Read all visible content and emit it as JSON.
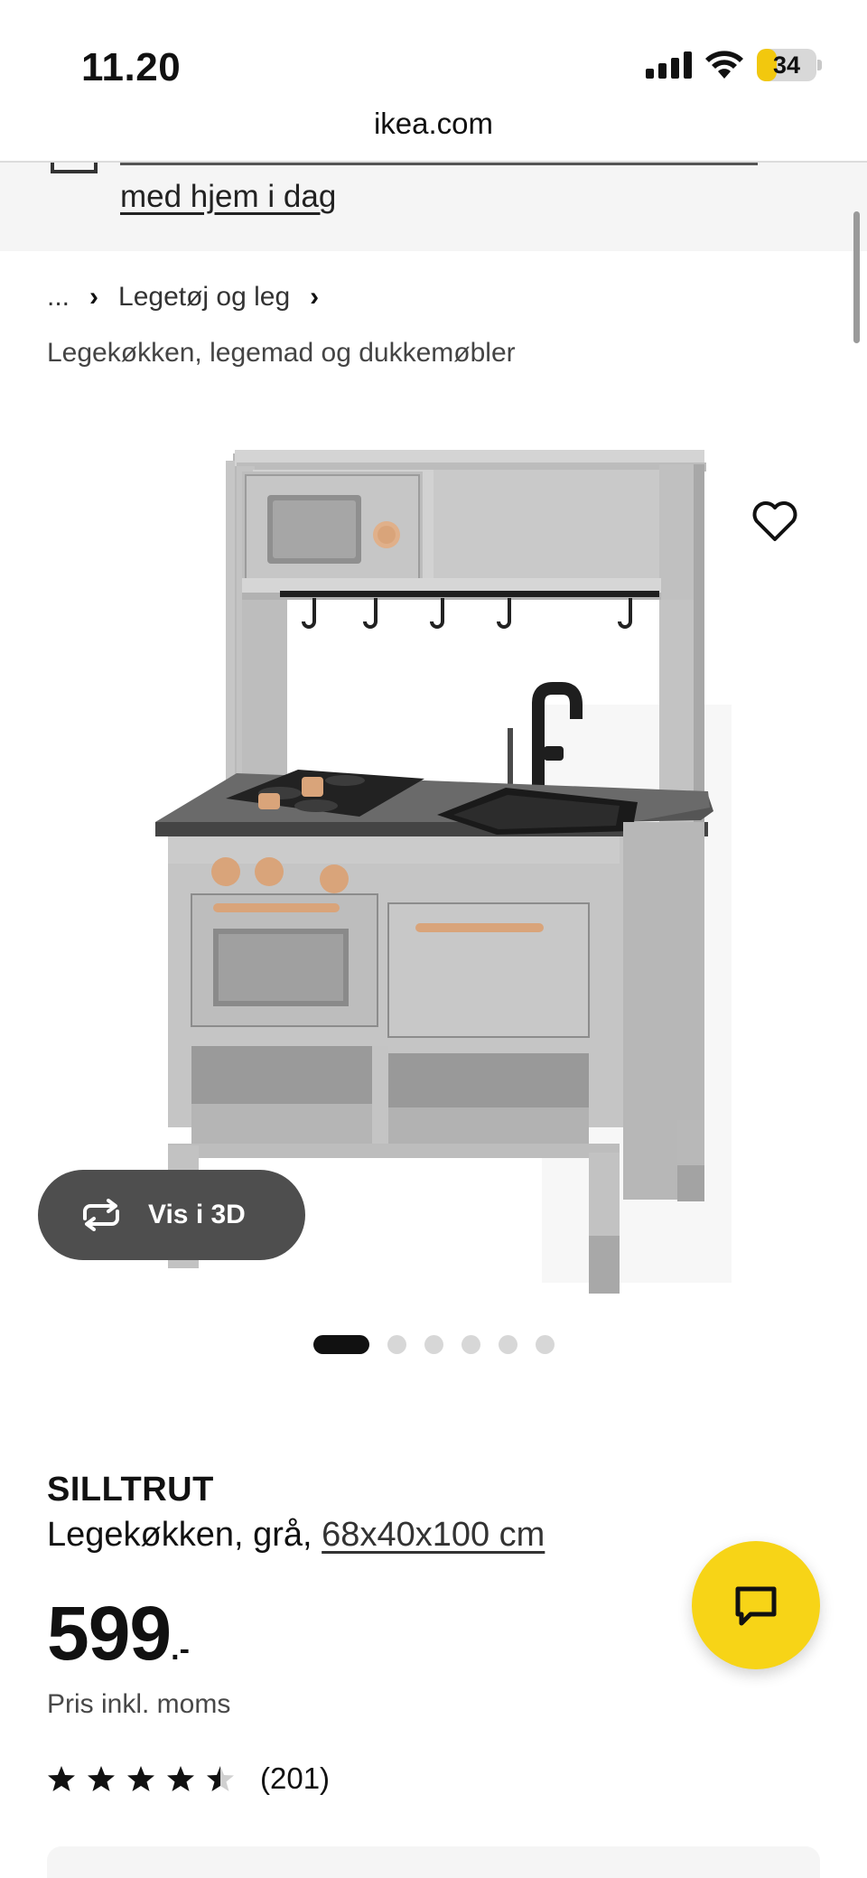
{
  "status": {
    "time": "11.20",
    "battery": "34",
    "battery_level": 0.34
  },
  "browser": {
    "url": "ikea.com"
  },
  "banner": {
    "link_text": "med hjem i dag"
  },
  "breadcrumb": {
    "ellipsis": "...",
    "category": "Legetøj og leg",
    "subcategory": "Legekøkken, legemad og dukkemøbler"
  },
  "gallery": {
    "view_3d_label": "Vis i 3D",
    "image_count": 6,
    "active_index": 0
  },
  "product": {
    "name": "SILLTRUT",
    "description": "Legekøkken, grå, ",
    "dimensions": "68x40x100 cm",
    "price": "599",
    "price_suffix": ".-",
    "price_note": "Pris inkl. moms",
    "rating": 4.5,
    "rating_max": 5,
    "review_count": "(201)"
  },
  "colors": {
    "accent_yellow": "#f7d417",
    "button_dark": "#4e4e4e",
    "text": "#111111"
  },
  "icons": [
    "signal-icon",
    "wifi-icon",
    "battery-icon",
    "heart-icon",
    "rotate-3d-icon",
    "chat-icon",
    "star-icon"
  ]
}
